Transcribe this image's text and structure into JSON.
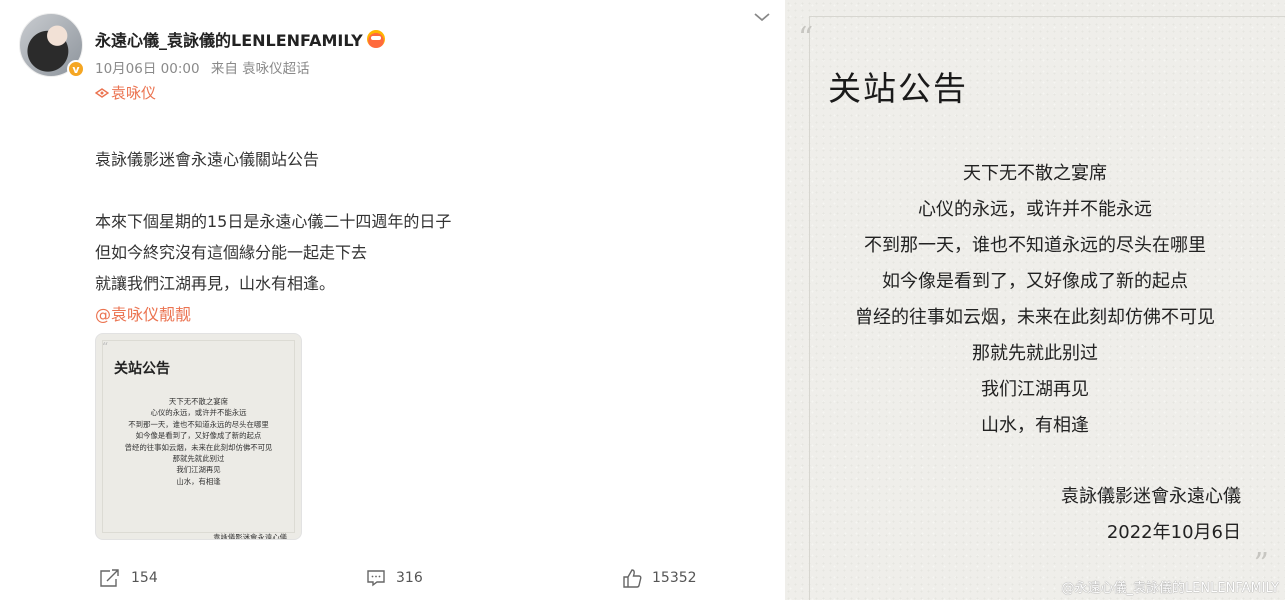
{
  "post": {
    "username": "永遠心儀_袁詠儀的LENLENFAMILY",
    "verified_mark": "v",
    "time": "10月06日 00:00",
    "source": "来自 袁咏仪超话",
    "location": "袁咏仪",
    "content_lines": [
      "袁詠儀影迷會永遠心儀關站公告",
      "",
      "本來下個星期的15日是永遠心儀二十四週年的日子",
      "但如今終究沒有這個緣分能一起走下去",
      "就讓我們江湖再見，山水有相逢。"
    ],
    "mention": "@袁咏仪靓靓",
    "actions": {
      "repost_count": "154",
      "comment_count": "316",
      "like_count": "15352"
    }
  },
  "image": {
    "open_quote": "“",
    "close_quote": "”",
    "title": "关站公告",
    "poem_lines": [
      "天下无不散之宴席",
      "心仪的永远，或许并不能永远",
      "不到那一天，谁也不知道永远的尽头在哪里",
      "如今像是看到了，又好像成了新的起点",
      "曾经的往事如云烟，未来在此刻却仿佛不可见",
      "那就先就此别过",
      "我们江湖再见",
      "山水，有相逢"
    ],
    "signature": "袁詠儀影迷會永遠心儀",
    "date": "2022年10月6日",
    "watermark": "@永遠心儀_袁詠儀的LENLENFAMILY"
  },
  "colors": {
    "accent": "#eb7350",
    "verified": "#f5a623"
  }
}
